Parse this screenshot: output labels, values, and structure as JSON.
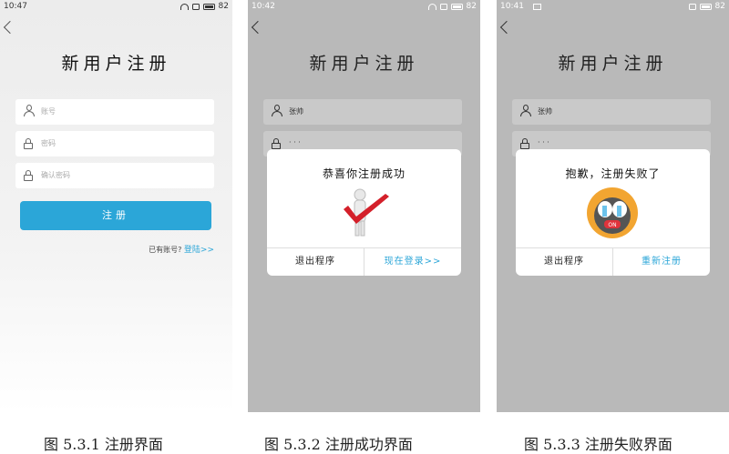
{
  "screens": [
    {
      "status_time": "10:47",
      "battery": "82",
      "title": "新用户注册",
      "account_placeholder": "账号",
      "password_placeholder": "密码",
      "confirm_placeholder": "确认密码",
      "register_button": "注册",
      "have_account_text": "已有账号?",
      "login_link": "登陆>>",
      "caption": "图 5.3.1 注册界面"
    },
    {
      "status_time": "10:42",
      "battery": "82",
      "title": "新用户注册",
      "account_value": "张帅",
      "password_value": "· · ·",
      "dialog_title": "恭喜你注册成功",
      "dialog_left": "退出程序",
      "dialog_right": "现在登录>>",
      "caption": "图 5.3.2 注册成功界面"
    },
    {
      "status_time": "10:41",
      "battery": "82",
      "title": "新用户注册",
      "account_value": "张帅",
      "password_value": "· · ·",
      "dialog_title": "抱歉，注册失败了",
      "dialog_left": "退出程序",
      "dialog_right": "重新注册",
      "caption": "图 5.3.3 注册失败界面"
    }
  ],
  "colors": {
    "accent": "#2ba6d8",
    "check_red": "#d4202a",
    "face_orange": "#f2a531",
    "overlay_gray": "#b9b9b9"
  }
}
